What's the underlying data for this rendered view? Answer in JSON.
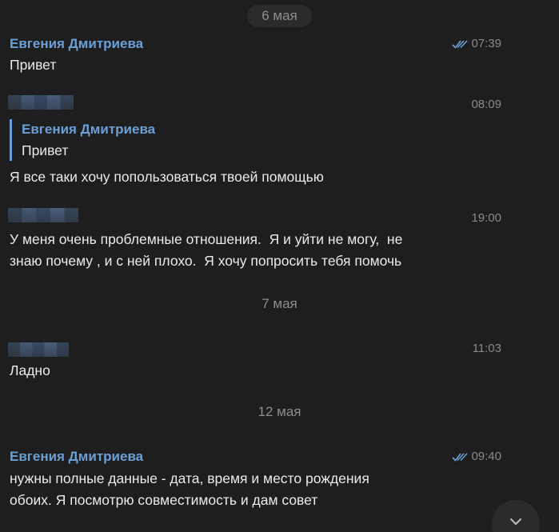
{
  "dates": {
    "first": "6 мая",
    "second": "7 мая",
    "third": "12 мая"
  },
  "messages": [
    {
      "sender": "Евгения Дмитриева",
      "time": "07:39",
      "read": true,
      "text": "Привет"
    },
    {
      "sender": "",
      "time": "08:09",
      "reply_to": {
        "sender": "Евгения Дмитриева",
        "text": "Привет"
      },
      "text": "Я все таки хочу попользоваться твоей помощью"
    },
    {
      "sender": "",
      "time": "19:00",
      "text": "У меня очень проблемные отношения.  Я и уйти не могу,  не\nзнаю почему , и с ней плохо.  Я хочу попросить тебя помочь"
    },
    {
      "sender": "",
      "time": "11:03",
      "text": "Ладно"
    },
    {
      "sender": "Евгения Дмитриева",
      "time": "09:40",
      "read": true,
      "text": "нужны полные данные - дата, время и место рождения\nобоих. Я посмотрю совместимость и дам совет"
    }
  ],
  "icons": {
    "read_receipt": "double-check-icon",
    "scroll_down": "chevron-down-icon"
  },
  "colors": {
    "background": "#1e1e1e",
    "accent": "#6b9fd6",
    "muted": "#8a8a8a"
  }
}
